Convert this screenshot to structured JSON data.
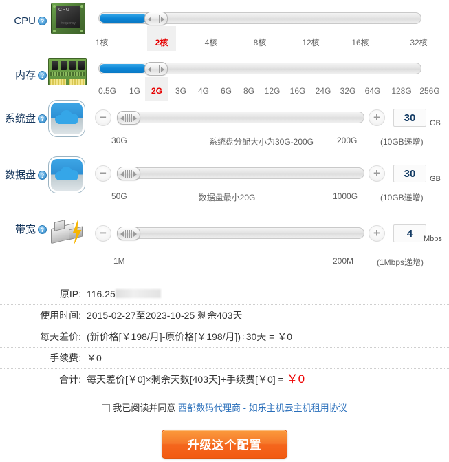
{
  "rows": {
    "cpu": {
      "label": "CPU",
      "help": "?",
      "icon": "cpu-chip-icon",
      "ticks": [
        "1核",
        "2核",
        "4核",
        "8核",
        "12核",
        "16核",
        "32核"
      ],
      "selected_tick": "2核",
      "selected_index": 1
    },
    "memory": {
      "label": "内存",
      "help": "?",
      "icon": "ram-stick-icon",
      "ticks": [
        "0.5G",
        "1G",
        "2G",
        "3G",
        "4G",
        "6G",
        "8G",
        "12G",
        "16G",
        "24G",
        "32G",
        "64G",
        "128G",
        "256G"
      ],
      "selected_tick": "2G",
      "selected_index": 2
    },
    "system_disk": {
      "label": "系统盘",
      "help": "?",
      "icon": "cloud-disk-icon",
      "minus": "−",
      "plus": "+",
      "value": "30",
      "unit": "GB",
      "min_label": "30G",
      "max_label": "200G",
      "hint": "系统盘分配大小为30G-200G",
      "step_note": "(10GB递增)"
    },
    "data_disk": {
      "label": "数据盘",
      "help": "?",
      "icon": "cloud-disk-icon",
      "minus": "−",
      "plus": "+",
      "value": "30",
      "unit": "GB",
      "min_label": "50G",
      "max_label": "1000G",
      "hint": "数据盘最小20G",
      "step_note": "(10GB递增)"
    },
    "bandwidth": {
      "label": "带宽",
      "help": "?",
      "icon": "network-plug-icon",
      "minus": "−",
      "plus": "+",
      "value": "4",
      "unit": "Mbps",
      "min_label": "1M",
      "max_label": "200M",
      "hint": "",
      "step_note": "(1Mbps递增)"
    }
  },
  "summary": [
    {
      "label": "原IP:",
      "value": "116.25",
      "redacted": true
    },
    {
      "label": "使用时间:",
      "value": "2015-02-27至2023-10-25  剩余403天",
      "redacted": false
    },
    {
      "label": "每天差价:",
      "value": "(新价格[￥198/月]-原价格[￥198/月])÷30天 = ￥0",
      "redacted": false
    },
    {
      "label": "手续费:",
      "value": "￥0",
      "redacted": false
    },
    {
      "label": "合计:",
      "value": "每天差价[￥0]×剩余天数[403天]+手续费[￥0] = ",
      "total": "￥0",
      "redacted": false
    }
  ],
  "agreement": {
    "checkbox_checked": false,
    "text": "我已阅读并同意",
    "link": "西部数码代理商 - 如乐主机云主机租用协议"
  },
  "submit": {
    "label": "升级这个配置"
  },
  "colors": {
    "accent_blue": "#0c86d6",
    "selected_red": "#e60000",
    "submit_orange": "#f4661d",
    "link_blue": "#2a6fbb",
    "label_navy": "#15365c"
  }
}
